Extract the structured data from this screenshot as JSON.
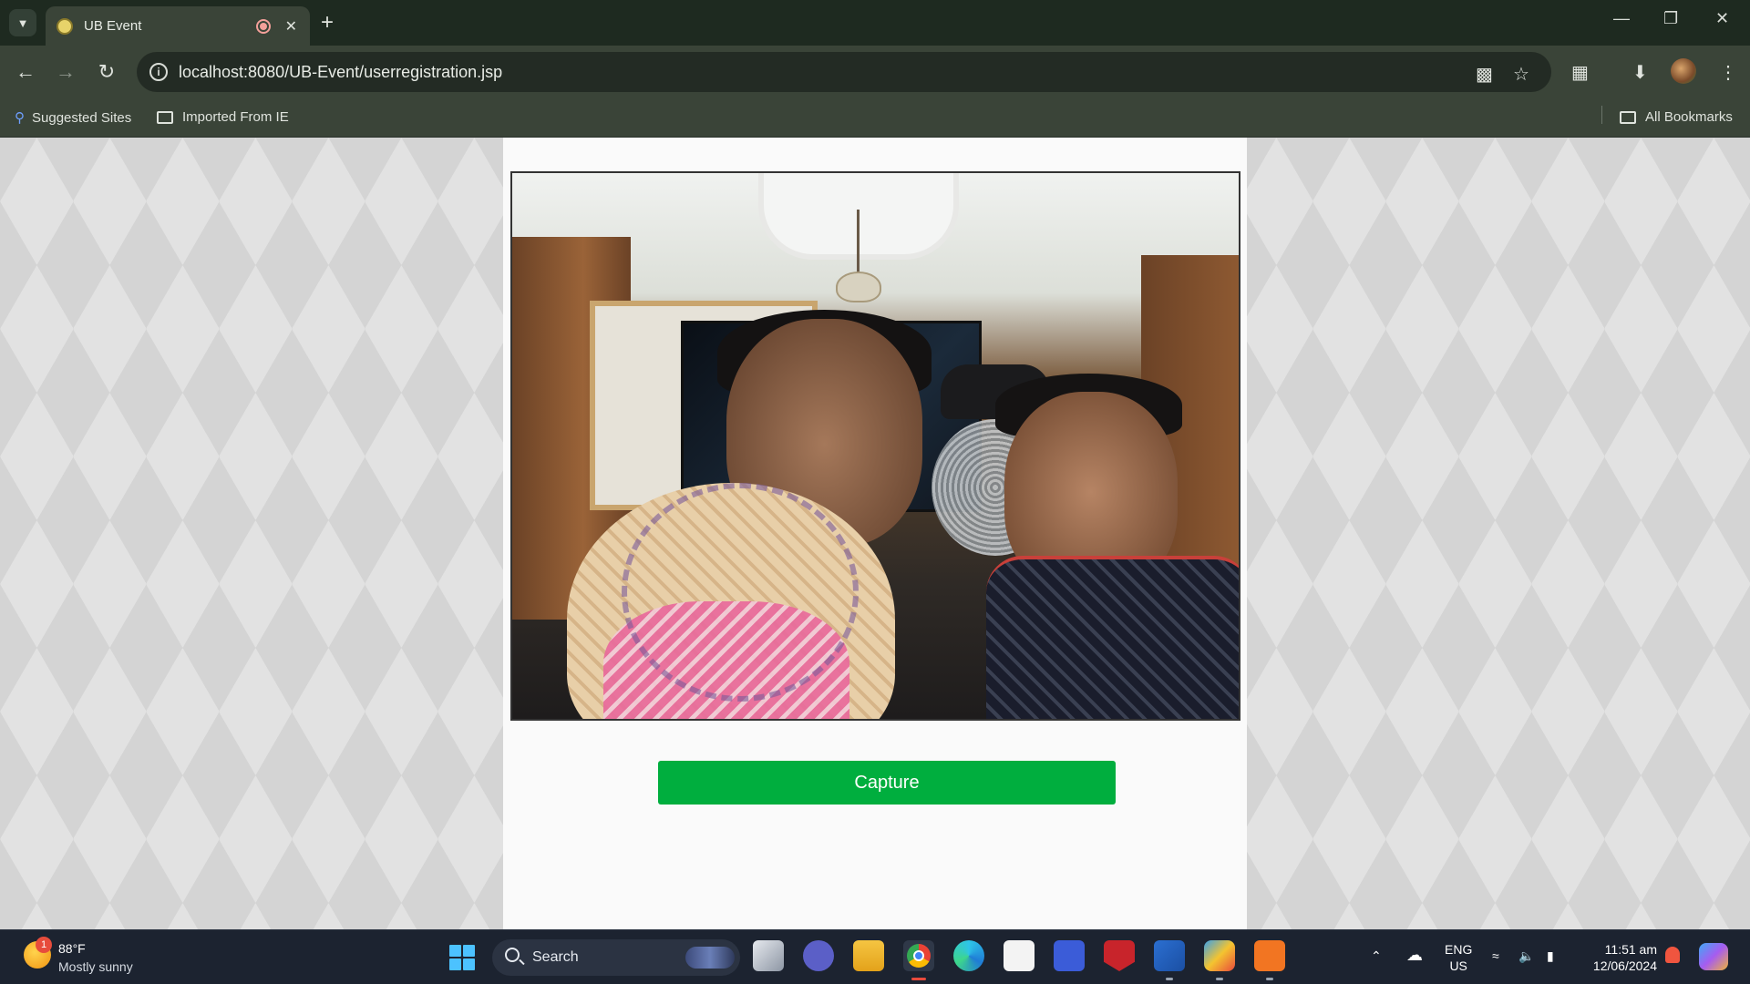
{
  "browser": {
    "tab_title": "UB Event",
    "url": "localhost:8080/UB-Event/userregistration.jsp",
    "bookmarks": {
      "suggested_sites": "Suggested Sites",
      "imported_from_ie": "Imported From IE",
      "all_bookmarks": "All Bookmarks"
    },
    "icons": {
      "tab_search": "chevron-down-icon",
      "tab_close": "close-icon",
      "new_tab": "plus-icon",
      "back": "arrow-left-icon",
      "forward": "arrow-right-icon",
      "reload": "reload-icon",
      "site_info": "info-icon",
      "camera_in_use": "video-camera-icon",
      "bookmark": "star-icon",
      "extensions": "puzzle-icon",
      "downloads": "download-icon",
      "menu": "kebab-menu-icon"
    }
  },
  "page": {
    "capture_label": "Capture",
    "capture_color": "#00ae3e"
  },
  "taskbar": {
    "weather": {
      "badge": "1",
      "temperature": "88°F",
      "description": "Mostly sunny"
    },
    "search_label": "Search",
    "language": {
      "line1": "ENG",
      "line2": "US"
    },
    "clock": {
      "time": "11:51 am",
      "date": "12/06/2024"
    }
  }
}
